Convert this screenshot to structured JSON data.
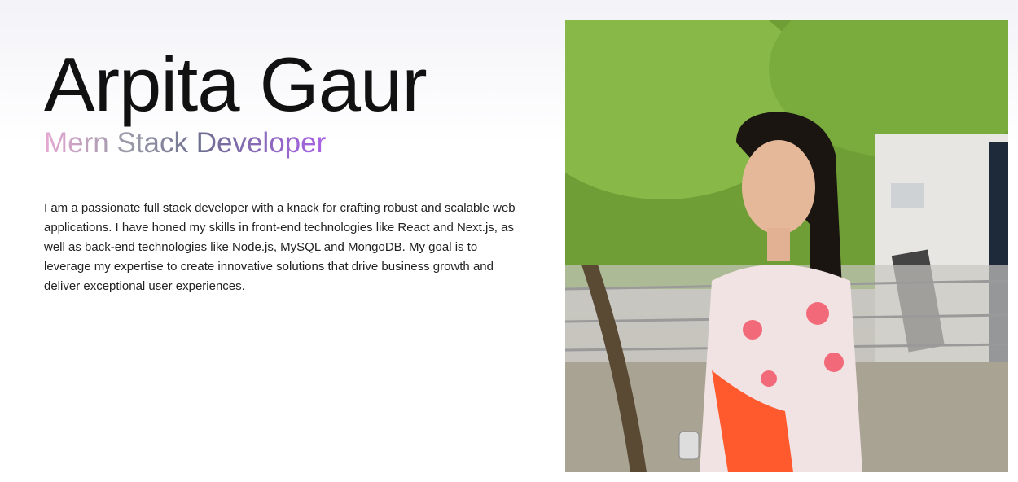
{
  "hero": {
    "name": "Arpita Gaur",
    "role": "Mern Stack Developer",
    "bio": "I am a passionate full stack developer with a knack for crafting robust and scalable web applications. I have honed my skills in front-end technologies like React and Next.js, as well as back-end technologies like Node.js, MySQL and MongoDB. My goal is to leverage my expertise to create innovative solutions that drive business growth and deliver exceptional user experiences."
  },
  "colors": {
    "gradient_start": "#e6a8d2",
    "gradient_mid": "#6d6f8f",
    "gradient_end": "#a862e6"
  }
}
